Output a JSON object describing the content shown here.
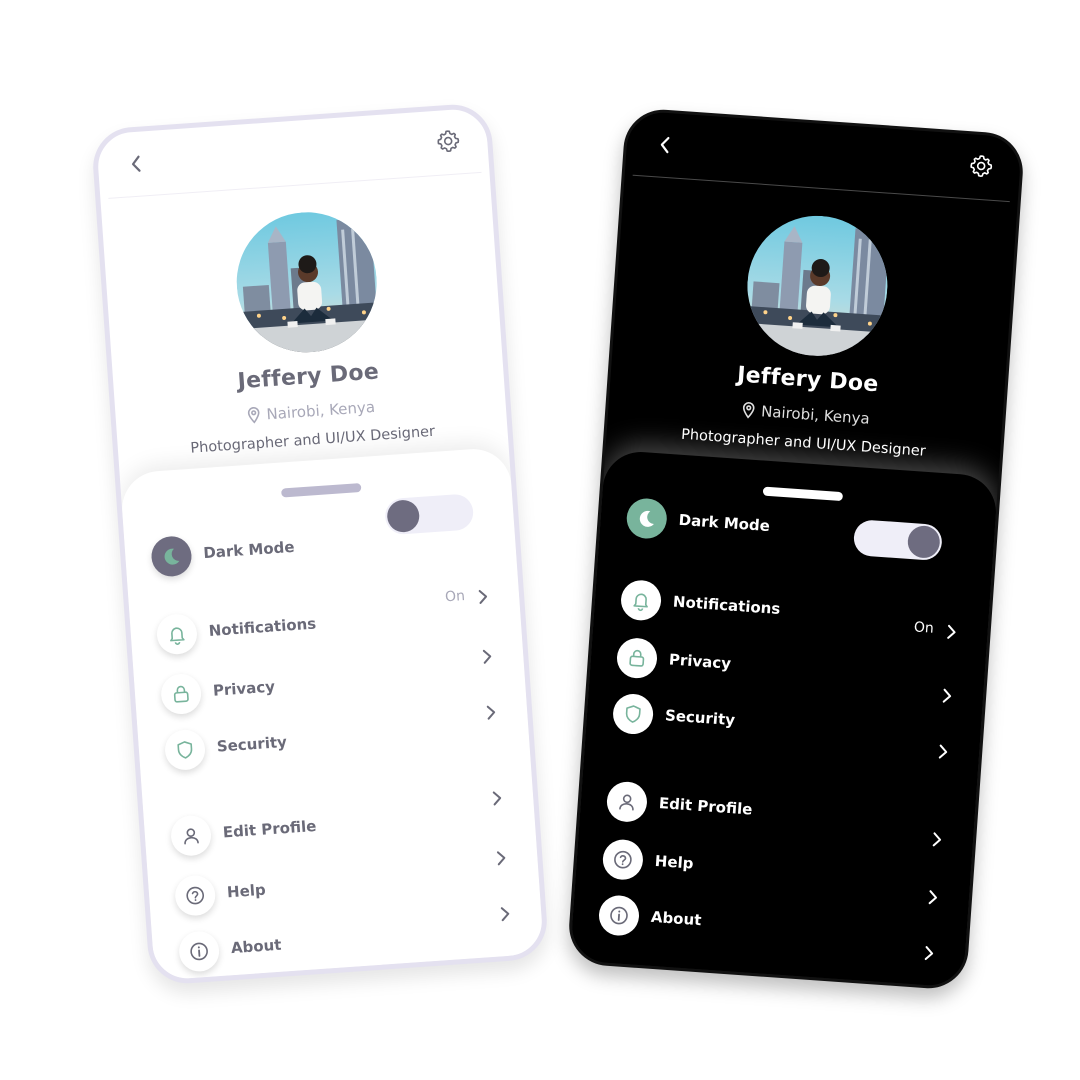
{
  "profile": {
    "name": "Jeffery Doe",
    "location": "Nairobi, Kenya",
    "bio": "Photographer and UI/UX Designer"
  },
  "settings": {
    "dark_mode": "Dark Mode",
    "notifications": "Notifications",
    "notifications_status": "On",
    "privacy": "Privacy",
    "security": "Security",
    "edit_profile": "Edit Profile",
    "help": "Help",
    "about": "About"
  },
  "light_screen": {
    "dark_mode_on": false
  },
  "dark_screen": {
    "dark_mode_on": true
  },
  "colors": {
    "accent": "#78b49c",
    "toggle_knob": "#6e6c80",
    "toggle_track": "#efeef8",
    "light_text": "#6a6a78",
    "muted_text": "#a8a8b8"
  },
  "icons": [
    "back-icon",
    "gear-icon",
    "location-pin-icon",
    "moon-icon",
    "bell-icon",
    "lock-icon",
    "shield-icon",
    "user-icon",
    "help-icon",
    "info-icon",
    "chevron-right-icon"
  ]
}
